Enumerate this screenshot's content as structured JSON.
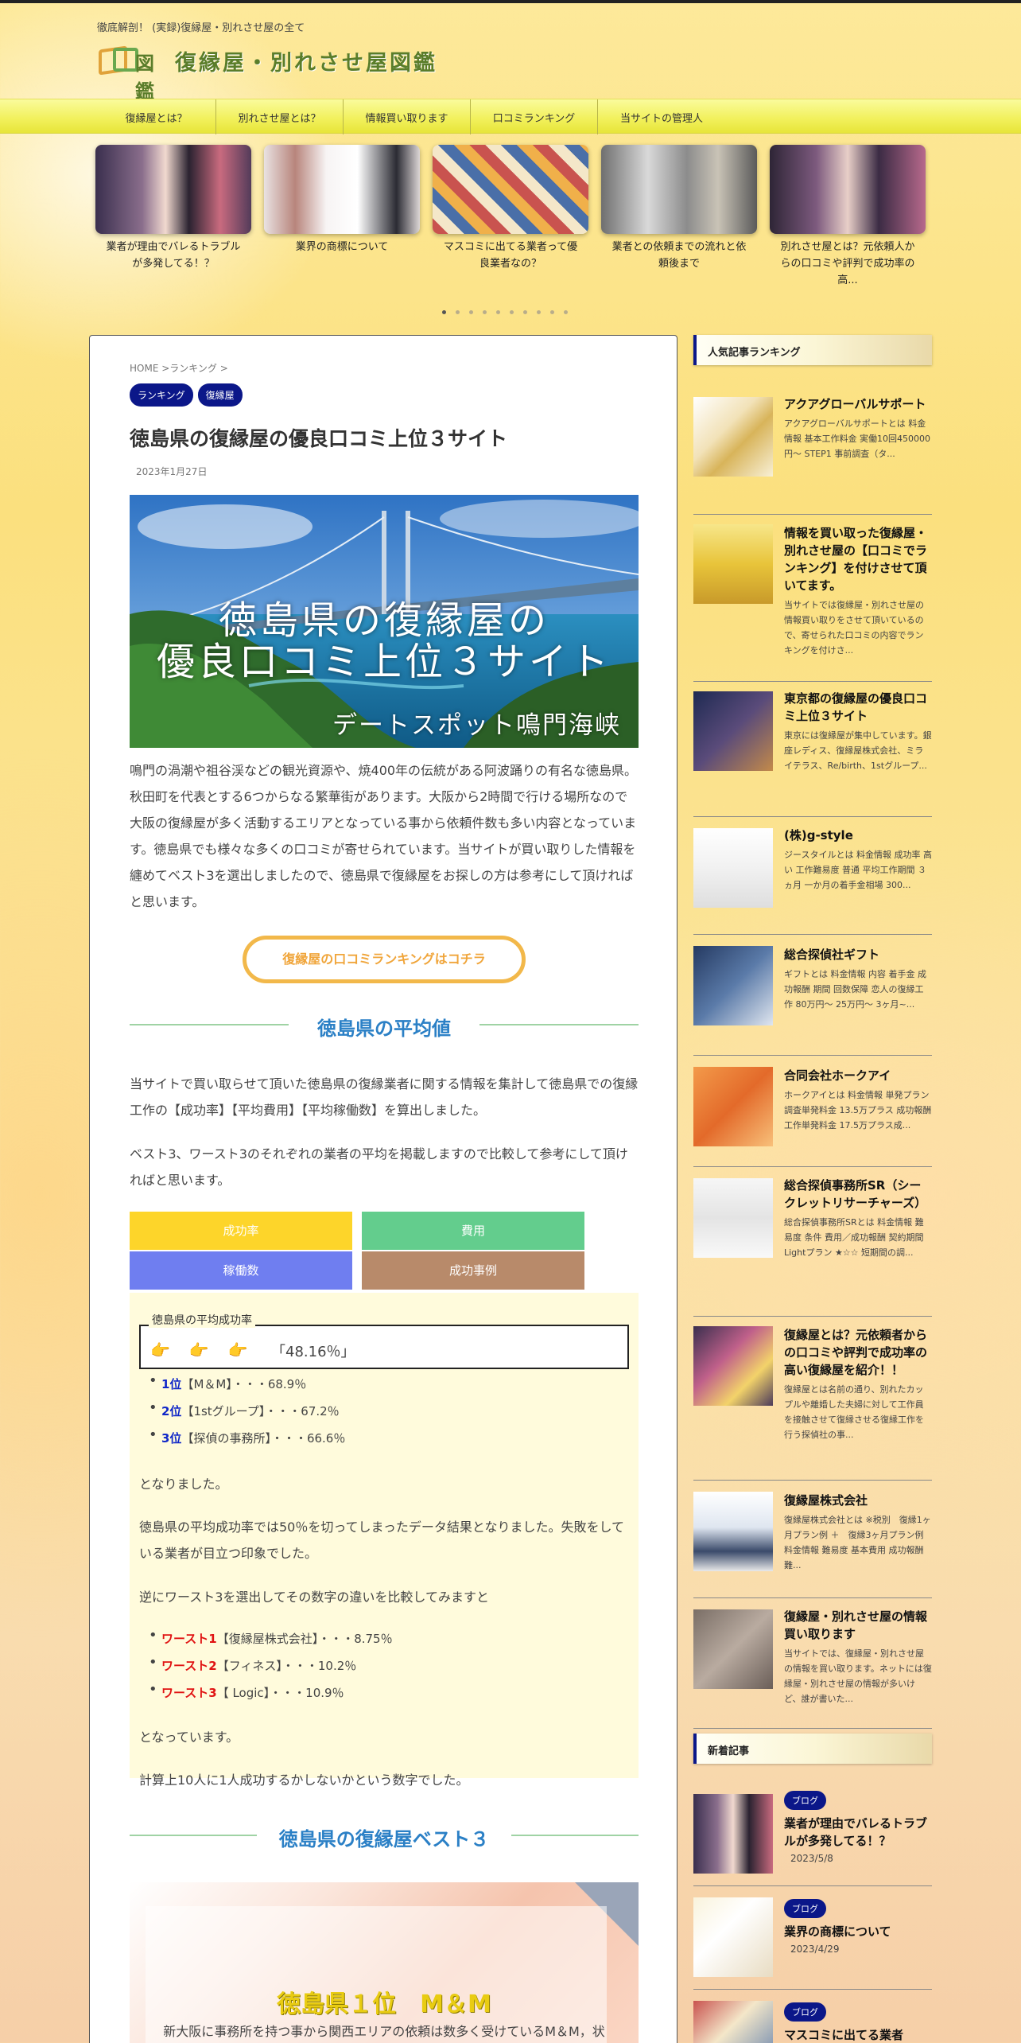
{
  "site": {
    "tagline": "徹底解剖！ (実録)復縁屋・別れさせ屋の全て",
    "logo_mark": "図鑑",
    "logo_text": "復縁屋・別れさせ屋図鑑"
  },
  "nav": [
    "復縁屋とは？",
    "別れさせ屋とは？",
    "情報買い取ります",
    "口コミランキング",
    "当サイトの管理人"
  ],
  "carousel": [
    {
      "caption": "業者が理由でバレるトラブルが多発してる！？"
    },
    {
      "caption": "業界の商標について"
    },
    {
      "caption": "マスコミに出てる業者って優良業者なの？"
    },
    {
      "caption": "業者との依頼までの流れと依頼後まで"
    },
    {
      "caption": "別れさせ屋とは？元依頼人からの口コミや評判で成功率の高..."
    }
  ],
  "article": {
    "breadcrumb": "HOME >ランキング >",
    "categories": [
      "ランキング",
      "復縁屋"
    ],
    "title": "徳島県の復縁屋の優良口コミ上位３サイト",
    "date": "2023年1月27日",
    "hero": {
      "line1": "徳島県の復縁屋の",
      "line2": "優良口コミ上位３サイト",
      "caption": "デートスポット鳴門海峡"
    },
    "intro": "鳴門の渦潮や祖谷渓などの観光資源や、焼400年の伝統がある阿波踊りの有名な徳島県。秋田町を代表とする6つからなる繁華街があります。大阪から2時間で行ける場所なので大阪の復縁屋が多く活動するエリアとなっている事から依頼件数も多い内容となっています。徳島県でも様々な多くの口コミが寄せられています。当サイトが買い取りした情報を纏めてベスト3を選出しましたので、徳島県で復縁屋をお探しの方は参考にして頂ければと思います。",
    "cta": "復縁屋の口コミランキングはコチラ",
    "avg_heading": "徳島県の平均値",
    "avg_para1": "当サイトで買い取らせて頂いた徳島県の復縁業者に関する情報を集計して徳島県での復縁工作の【成功率】【平均費用】【平均稼働数】を算出しました。",
    "avg_para2": "ベスト3、ワースト3のそれぞれの業者の平均を掲載しますので比較して参考にして頂ければと思います。",
    "buttons": [
      {
        "label": "成功率",
        "color": "#fdd52a"
      },
      {
        "label": "費用",
        "color": "#63cd8d"
      },
      {
        "label": "稼働数",
        "color": "#6f7ef0"
      },
      {
        "label": "成功事例",
        "color": "#b88a6a"
      }
    ],
    "panel": {
      "label": "徳島県の平均成功率",
      "hands": "👉👉👉",
      "value": "「48.16％」",
      "best": [
        {
          "rank": "1位",
          "text": "【M＆M】・・・68.9％"
        },
        {
          "rank": "2位",
          "text": "【1stグループ】・・・67.2％"
        },
        {
          "rank": "3位",
          "text": "【探偵の事務所】・・・66.6％"
        }
      ],
      "result": "となりました。",
      "comment": "徳島県の平均成功率では50％を切ってしまったデータ結果となりました。失敗をしている業者が目立つ印象でした。",
      "worst_intro": "逆にワースト3を選出してその数字の違いを比較してみますと",
      "worst": [
        {
          "rank": "ワースト1",
          "text": "【復縁屋株式会社】・・・8.75％"
        },
        {
          "rank": "ワースト2",
          "text": "【フィネス】・・・10.2％"
        },
        {
          "rank": "ワースト3",
          "text": "【 Logic】・・・10.9％"
        }
      ],
      "result2": "となっています。",
      "closing": "計算上10人に1人成功するかしないかという数字でした。"
    },
    "best_heading": "徳島県の復縁屋ベスト３",
    "best_card": {
      "title": "徳島県１位　M＆M",
      "text": "新大阪に事務所を持つ事から関西エリアの依頼は数多く受けているM＆M，状"
    }
  },
  "sidebar": {
    "popular_title": "人気記事ランキング",
    "popular": [
      {
        "title": "アクアグローバルサポート",
        "excerpt": "アクアグローバルサポートとは 料金情報 基本工作料金 実働10回450000円～ STEP1 事前調査（タ..."
      },
      {
        "title": "情報を買い取った復縁屋・別れさせ屋の【口コミでランキング】を付けさせて頂いてます。",
        "excerpt": "当サイトでは復縁屋・別れさせ屋の情報買い取りをさせて頂いているので、寄せられた口コミの内容でランキングを付けさ..."
      },
      {
        "title": "東京都の復縁屋の優良口コミ上位３サイト",
        "excerpt": "東京には復縁屋が集中しています。銀座レディス、復縁屋株式会社、ミライテラス、Re/birth、1stグループ..."
      },
      {
        "title": "(株)g-style",
        "excerpt": "ジースタイルとは 料金情報 成功率 高い 工作難易度 普通 平均工作期間 ３ヵ月 一か月の着手金相場 300..."
      },
      {
        "title": "総合探偵社ギフト",
        "excerpt": "ギフトとは 料金情報 内容 着手金 成功報酬 期間 回数保障 恋人の復縁工作 80万円～ 25万円～ 3ヶ月~..."
      },
      {
        "title": "合同会社ホークアイ",
        "excerpt": "ホークアイとは 料金情報 単発プラン 調査単発料金 13.5万プラス 成功報酬 工作単発料金 17.5万プラス成..."
      },
      {
        "title": "総合探偵事務所SR（シークレットリサーチャーズ）",
        "excerpt": "総合探偵事務所SRとは 料金情報 難易度 条件 費用／成功報酬 契約期間 Lightプラン ★☆☆ 短期間の調..."
      },
      {
        "title": "復縁屋とは？元依頼者からの口コミや評判で成功率の高い復縁屋を紹介！！",
        "excerpt": "復縁屋とは名前の通り、別れたカップルや離婚した夫婦に対して工作員を接触させて復縁させる復縁工作を行う探偵社の事..."
      },
      {
        "title": "復縁屋株式会社",
        "excerpt": "復縁屋株式会社とは ※税別　復縁1ヶ月プラン例 ＋　復縁3ヶ月プラン例 料金情報 難易度 基本費用 成功報酬 難..."
      },
      {
        "title": "復縁屋・別れさせ屋の情報買い取ります",
        "excerpt": "当サイトでは、復縁屋・別れさせ屋の情報を買い取ります。ネットには復縁屋・別れさせ屋の情報が多いけど、誰が書いた..."
      }
    ],
    "new_title": "新着記事",
    "new": [
      {
        "tag": "ブログ",
        "title": "業者が理由でバレるトラブルが多発してる！？",
        "date": "2023/5/8"
      },
      {
        "tag": "ブログ",
        "title": "業界の商標について",
        "date": "2023/4/29"
      },
      {
        "tag": "ブログ",
        "title": "マスコミに出てる業者",
        "date": ""
      }
    ]
  }
}
